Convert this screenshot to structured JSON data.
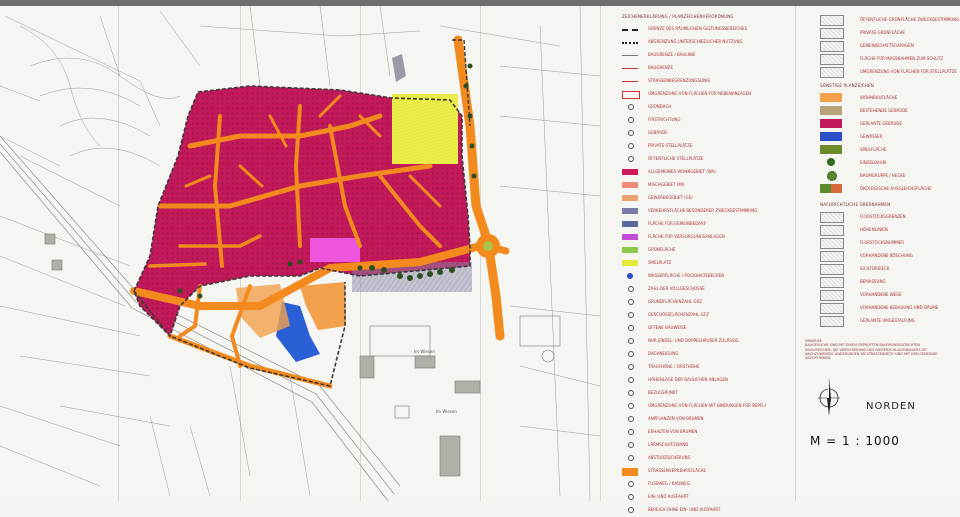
{
  "map": {
    "colors": {
      "residential": "#c2195a",
      "road": "#f28a1e",
      "green_field": "#ecee4a",
      "special_area": "#ee55dd",
      "water": "#2a5fd6",
      "commercial": "#8a8aa6",
      "orange_block": "#f2a04c",
      "boundary": "#3a3a3a"
    },
    "street_labels": [
      "Im Wiesen",
      "Im Wiesen"
    ]
  },
  "legend": {
    "left_title": "ZEICHENERKLÄRUNG / PLANZEICHENVERORDNUNG",
    "left_items": [
      {
        "label": "GRENZE DES RÄUMLICHEN GELTUNGSBEREICHES",
        "symbol": "dashed-black"
      },
      {
        "label": "ABGRENZUNG UNTERSCHIEDLICHER NUTZUNG",
        "symbol": "dotted-black"
      },
      {
        "label": "BAUGRENZE / BAULINIE",
        "symbol": "thin-line"
      },
      {
        "label": "BAUGRENZE",
        "symbol": "red-line"
      },
      {
        "label": "STRASSENBEGRENZUNGSLINIE",
        "symbol": "red-line"
      },
      {
        "label": "UMGRENZUNG VON FLÄCHEN FÜR NEBENANLAGEN",
        "symbol": "red-box"
      },
      {
        "label": "GRÜNDACH",
        "symbol": "glyph"
      },
      {
        "label": "FIRSTRICHTUNG",
        "symbol": "glyph"
      },
      {
        "label": "GEBÄUDE",
        "symbol": "glyph"
      },
      {
        "label": "PRIVATE STELLPLÄTZE",
        "symbol": "glyph"
      },
      {
        "label": "ÖFFENTLICHE STELLPLÄTZE",
        "symbol": "glyph"
      },
      {
        "label": "ALLGEMEINES WOHNGEBIET (WA)",
        "symbol": "magenta"
      },
      {
        "label": "MISCHGEBIET (MI)",
        "symbol": "salmon"
      },
      {
        "label": "GEWERBEGEBIET (GE)",
        "symbol": "salmon2"
      },
      {
        "label": "VERKEHRSFLÄCHE BESONDERER ZWECKBESTIMMUNG",
        "symbol": "grey-blue"
      },
      {
        "label": "FLÄCHE FÜR GEMEINBEDARF",
        "symbol": "blue-grey"
      },
      {
        "label": "FLÄCHE FÜR VERSORGUNGSANLAGEN",
        "symbol": "violet"
      },
      {
        "label": "GRÜNFLÄCHE",
        "symbol": "green"
      },
      {
        "label": "SPIELPLATZ",
        "symbol": "yellow"
      },
      {
        "label": "WASSERFLÄCHE / RÜCKHALTEBECKEN",
        "symbol": "blue"
      },
      {
        "label": "ZAHL DER VOLLGESCHOSSE",
        "symbol": "glyph"
      },
      {
        "label": "GRUNDFLÄCHENZAHL GRZ",
        "symbol": "glyph"
      },
      {
        "label": "GESCHOSSFLÄCHENZAHL GFZ",
        "symbol": "glyph"
      },
      {
        "label": "OFFENE BAUWEISE",
        "symbol": "glyph"
      },
      {
        "label": "NUR EINZEL- UND DOPPELHÄUSER ZULÄSSIG",
        "symbol": "glyph"
      },
      {
        "label": "DACHNEIGUNG",
        "symbol": "glyph"
      },
      {
        "label": "TRAUFHÖHE / FIRSTHÖHE",
        "symbol": "glyph"
      },
      {
        "label": "HÖHENLAGE DER BAULICHEN ANLAGEN",
        "symbol": "glyph"
      },
      {
        "label": "BEZUGSPUNKT",
        "symbol": "glyph"
      },
      {
        "label": "UMGRENZUNG VON FLÄCHEN MIT BINDUNGEN FÜR BEPFLANZUNGEN",
        "symbol": "glyph"
      },
      {
        "label": "ANPFLANZEN VON BÄUMEN",
        "symbol": "glyph"
      },
      {
        "label": "ERHALTEN VON BÄUMEN",
        "symbol": "glyph"
      },
      {
        "label": "LÄRMSCHUTZWAND",
        "symbol": "glyph"
      },
      {
        "label": "ABSTURZSICHERUNG",
        "symbol": "glyph"
      },
      {
        "label": "STRASSENVERKEHRSFLÄCHE",
        "symbol": "orange"
      },
      {
        "label": "FUSSWEG / RADWEG",
        "symbol": "glyph"
      },
      {
        "label": "EIN- UND AUSFAHRT",
        "symbol": "glyph"
      },
      {
        "label": "BEREICH OHNE EIN- UND AUSFAHRT",
        "symbol": "glyph"
      }
    ],
    "right_items": [
      {
        "label": "ÖFFENTLICHE GRÜNFLÄCHE ZWECKBESTIMMUNG",
        "symbol": "sketch"
      },
      {
        "label": "PRIVATE GRÜNFLÄCHE",
        "symbol": "sketch"
      },
      {
        "label": "GEMEINSCHAFTSGARAGEN",
        "symbol": "sketch"
      },
      {
        "label": "FLÄCHE FÜR MASSNAHMEN ZUM SCHUTZ",
        "symbol": "sketch"
      },
      {
        "label": "UMGRENZUNG VON FLÄCHEN FÜR STELLPLÄTZE",
        "symbol": "sketch"
      }
    ],
    "right_title": "SONSTIGE PLANZEICHEN",
    "right_color_items": [
      {
        "label": "WOHNBAUFLÄCHE",
        "symbol": "orange2"
      },
      {
        "label": "BESTEHENDE GEBÄUDE",
        "symbol": "stone"
      },
      {
        "label": "GEPLANTE GEBÄUDE",
        "symbol": "crimson"
      },
      {
        "label": "GEWÄSSER",
        "symbol": "royal"
      },
      {
        "label": "SPIELFLÄCHE",
        "symbol": "olive"
      },
      {
        "label": "EINZELBAUM",
        "symbol": "tree"
      },
      {
        "label": "BAUMGRUPPE / HECKE",
        "symbol": "tree2"
      },
      {
        "label": "ÖKOLOGISCHE AUSGLEICHSFLÄCHE",
        "symbol": "mixed"
      }
    ],
    "right_title2": "NACHRICHTLICHE ÜBERNAHMEN",
    "right_lower_items": [
      {
        "label": "FLURSTÜCKSGRENZEN",
        "symbol": "sketch"
      },
      {
        "label": "HÖHENLINIEN",
        "symbol": "sketch"
      },
      {
        "label": "FLURSTÜCKSNUMMER",
        "symbol": "sketch"
      },
      {
        "label": "VORHANDENE BÖSCHUNG",
        "symbol": "sketch"
      },
      {
        "label": "SICHTDREIECK",
        "symbol": "sketch"
      },
      {
        "label": "BEMASSUNG",
        "symbol": "sketch"
      },
      {
        "label": "VORHANDENE WEGE",
        "symbol": "sketch"
      },
      {
        "label": "VORHANDENE BEBAUUNG UND BÄUME",
        "symbol": "sketch"
      },
      {
        "label": "GEPLANTE UMGESTALTUNG",
        "symbol": "sketch"
      }
    ],
    "note_title": "HINWEISE",
    "note_text": "BAUGESUCHE SIND MIT EINEM GEPRÜFTEN BAUGRUNDGUTACHTEN EINZUREICHEN. DIE VERSICKERUNG DES NIEDERSCHLAGSWASSERS IST NACHZUWEISEN. ÄNDERUNGEN AM STRASSENNETZ SIND MIT DER GEMEINDE ABZUSTIMMEN."
  },
  "compass": {
    "label": "NORDEN"
  },
  "scale": {
    "label": "M  =  1 : 1000"
  }
}
